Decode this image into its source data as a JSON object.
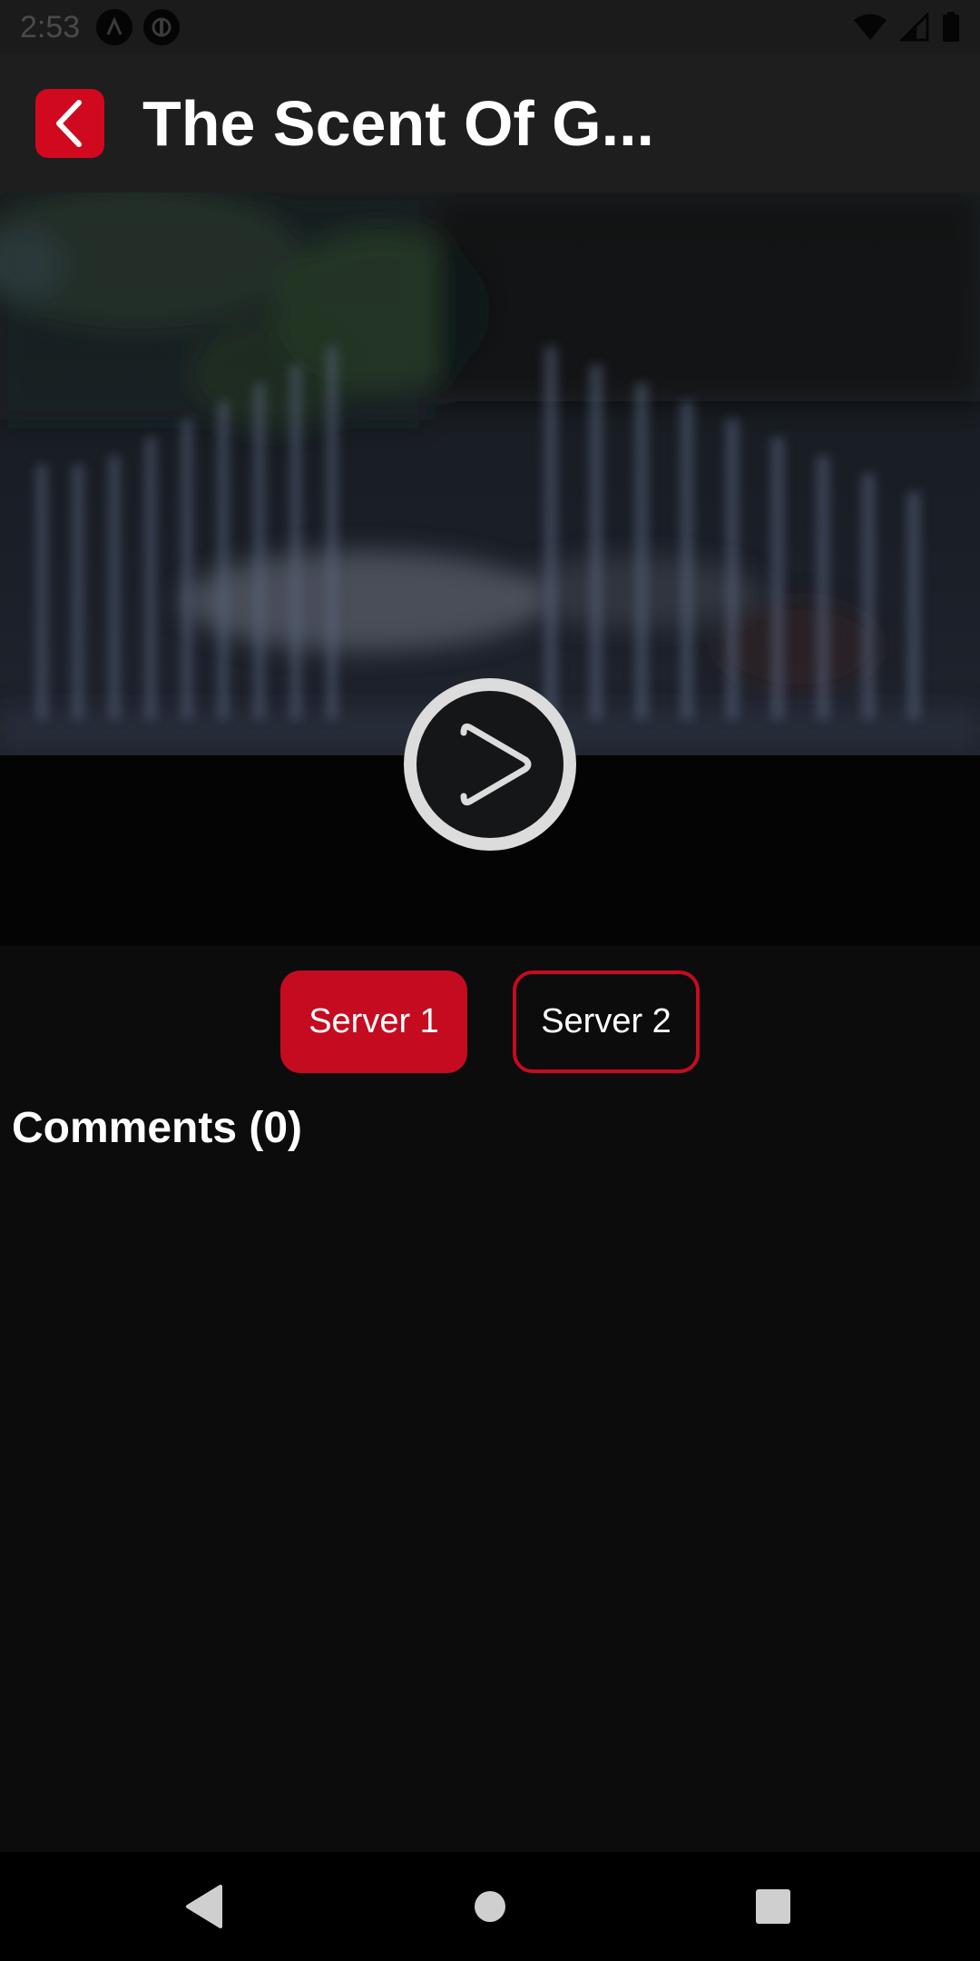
{
  "status_bar": {
    "time": "2:53",
    "notification_icons": [
      "app-notification-icon",
      "app-notification-icon"
    ],
    "system_icons": [
      "wifi-icon",
      "signal-icon",
      "battery-icon"
    ]
  },
  "header": {
    "back_icon": "chevron-left-icon",
    "title": "The Scent Of G...",
    "accent_color": "#d0091f"
  },
  "player": {
    "play_icon": "play-circle-icon"
  },
  "servers": {
    "options": [
      "Server 1",
      "Server 2"
    ],
    "selected": "Server 1"
  },
  "comments": {
    "heading": "Comments (0)"
  },
  "nav_bar": {
    "icons": [
      "back-triangle-icon",
      "home-circle-icon",
      "recents-square-icon"
    ]
  }
}
